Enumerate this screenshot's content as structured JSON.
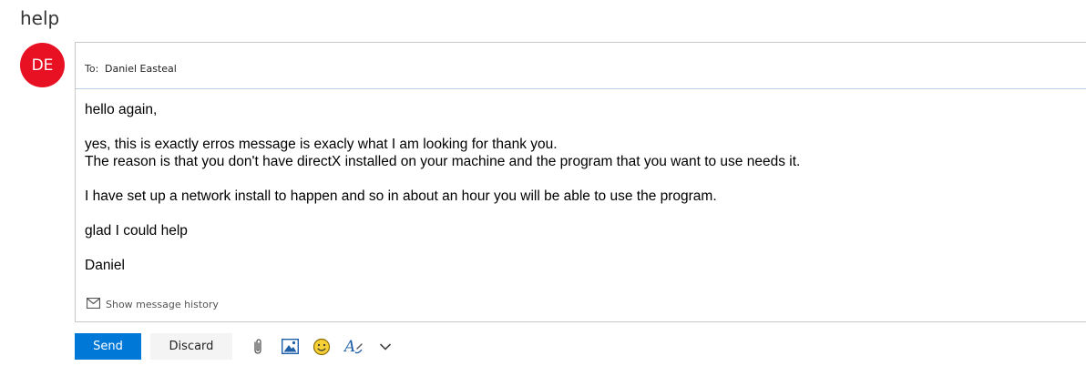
{
  "subject": "help",
  "avatar": {
    "initials": "DE",
    "color": "#e81123"
  },
  "recipients": {
    "label": "To:",
    "name": "Daniel Easteal"
  },
  "message": {
    "lines": [
      "hello again,",
      "",
      "yes, this is exactly erros message is exacly what I am looking for thank you.",
      "The reason is that you don't have directX installed on your machine and the program that you want to use needs it.",
      "",
      "I have set up a network install to happen and so in about an hour you will be able to use the program.",
      "",
      "glad I could help",
      "",
      "Daniel"
    ]
  },
  "history": {
    "label": "Show message history",
    "icon": "envelope-icon"
  },
  "toolbar": {
    "send_label": "Send",
    "discard_label": "Discard",
    "icons": [
      "paperclip-icon",
      "image-icon",
      "emoji-icon",
      "format-text-icon",
      "chevron-down-icon"
    ]
  },
  "colors": {
    "accent": "#0078d7",
    "avatar": "#e81123",
    "divider": "#b7cfe6"
  }
}
